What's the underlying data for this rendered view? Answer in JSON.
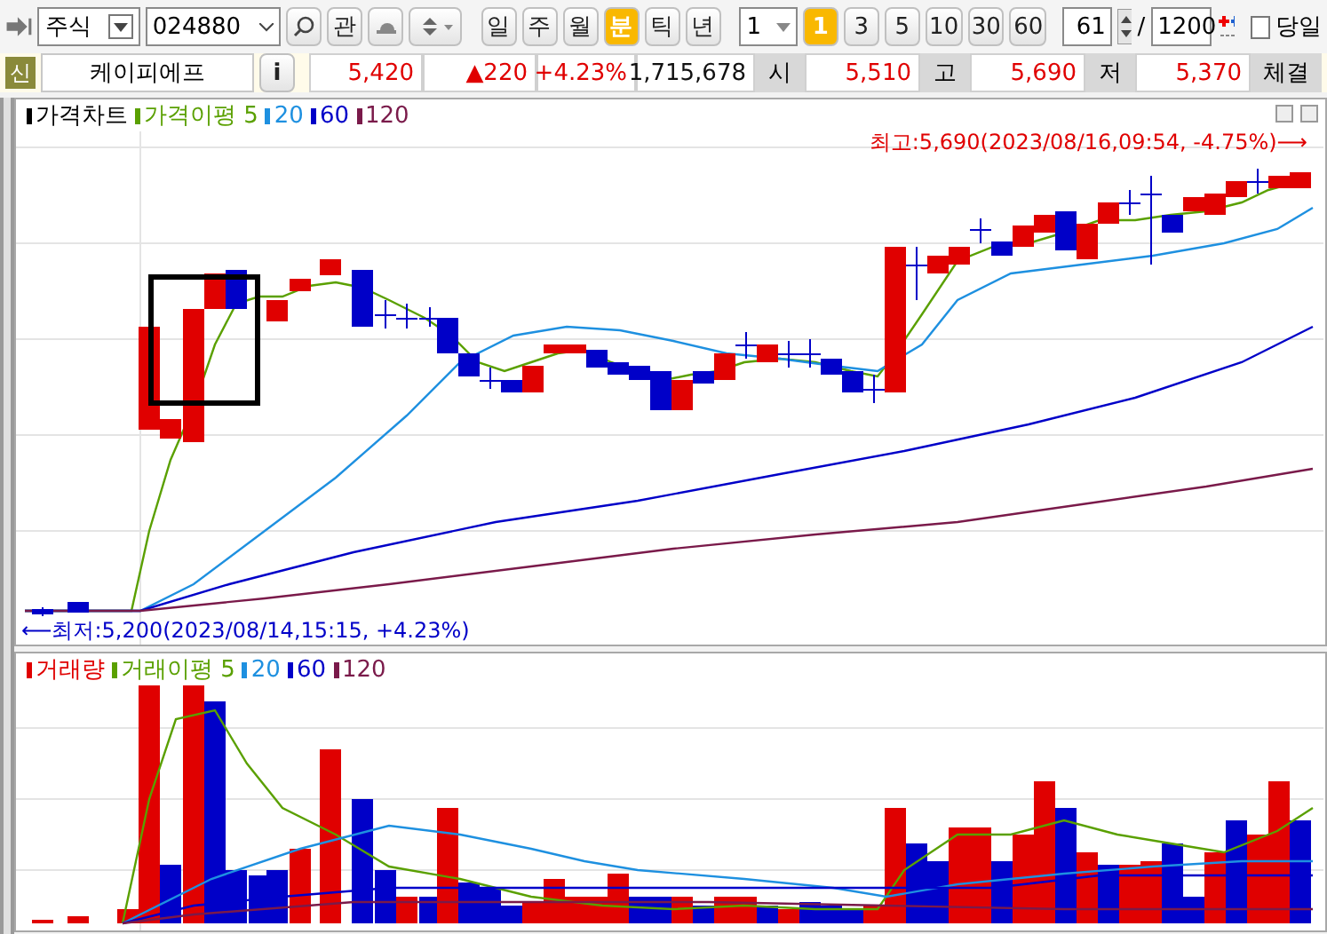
{
  "toolbar": {
    "market": "주식",
    "code": "024880",
    "watch_button": "관",
    "periods": [
      {
        "label": "일",
        "selected": false
      },
      {
        "label": "주",
        "selected": false
      },
      {
        "label": "월",
        "selected": false
      },
      {
        "label": "분",
        "selected": true
      },
      {
        "label": "틱",
        "selected": false
      },
      {
        "label": "년",
        "selected": false
      }
    ],
    "unit": "1",
    "intervals": [
      {
        "label": "1",
        "selected": true
      },
      {
        "label": "3",
        "selected": false
      },
      {
        "label": "5",
        "selected": false
      },
      {
        "label": "10",
        "selected": false
      },
      {
        "label": "30",
        "selected": false
      },
      {
        "label": "60",
        "selected": false
      }
    ],
    "bar_count": "61",
    "separator": "/",
    "total": "1200",
    "same_day": {
      "label": "당일",
      "checked": false
    }
  },
  "quote": {
    "badge": "신",
    "name": "케이피에프",
    "info": "i",
    "price": "5,420",
    "change": "▲220",
    "change_rate": "+4.23%",
    "volume": "1,715,678",
    "fields": [
      {
        "label": "시",
        "value": "5,510"
      },
      {
        "label": "고",
        "value": "5,690"
      },
      {
        "label": "저",
        "value": "5,370"
      }
    ],
    "last_label": "체결"
  },
  "price_chart": {
    "title": "가격차트",
    "legend": [
      {
        "label": "가격이평 5",
        "color": "#5aa000"
      },
      {
        "label": "20",
        "color": "#1e90e0"
      },
      {
        "label": "60",
        "color": "#0000c8"
      },
      {
        "label": "120",
        "color": "#7a1a4a"
      }
    ],
    "high_note": "최고:5,690(2023/08/16,09:54, -4.75%)⟶",
    "low_note": "⟵최저:5,200(2023/08/14,15:15, +4.23%)"
  },
  "volume_chart": {
    "title": "거래량",
    "legend": [
      {
        "label": "거래이평 5",
        "color": "#5aa000"
      },
      {
        "label": "20",
        "color": "#1e90e0"
      },
      {
        "label": "60",
        "color": "#0000c8"
      },
      {
        "label": "120",
        "color": "#7a1a4a"
      }
    ]
  }
}
